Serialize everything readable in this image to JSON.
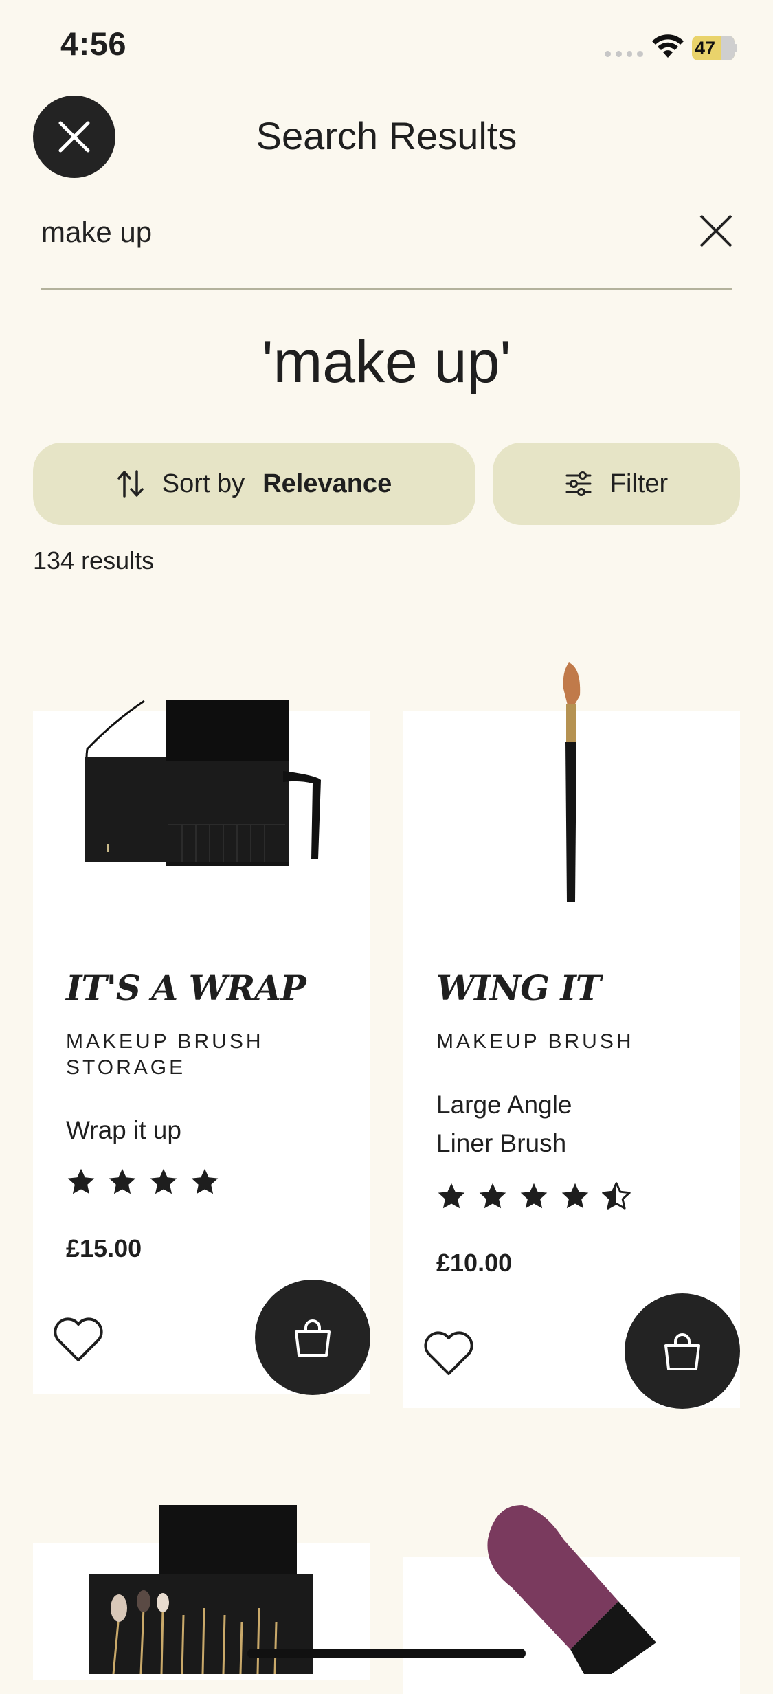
{
  "status_bar": {
    "time": "4:56",
    "battery": "47"
  },
  "header": {
    "title": "Search Results"
  },
  "search": {
    "value": "make up",
    "placeholder": ""
  },
  "query_heading": "'make up'",
  "sort": {
    "label": "Sort by",
    "value": "Relevance"
  },
  "filter": {
    "label": "Filter"
  },
  "results_count": "134 results",
  "products": [
    {
      "name": "IT'S A WRAP",
      "category_line1": "MAKEUP BRUSH",
      "category_line2": "STORAGE",
      "description_line1": "Wrap it up",
      "description_line2": "",
      "rating": 4,
      "price": "£15.00"
    },
    {
      "name": "WING IT",
      "category_line1": "MAKEUP BRUSH",
      "category_line2": "",
      "description_line1": "Large Angle",
      "description_line2": "Liner Brush",
      "rating": 4.5,
      "price": "£10.00"
    }
  ],
  "colors": {
    "accent_pill": "#e6e4c6",
    "dark": "#232323",
    "background": "#fbf8ef",
    "lipstick": "#7a3a5e"
  }
}
